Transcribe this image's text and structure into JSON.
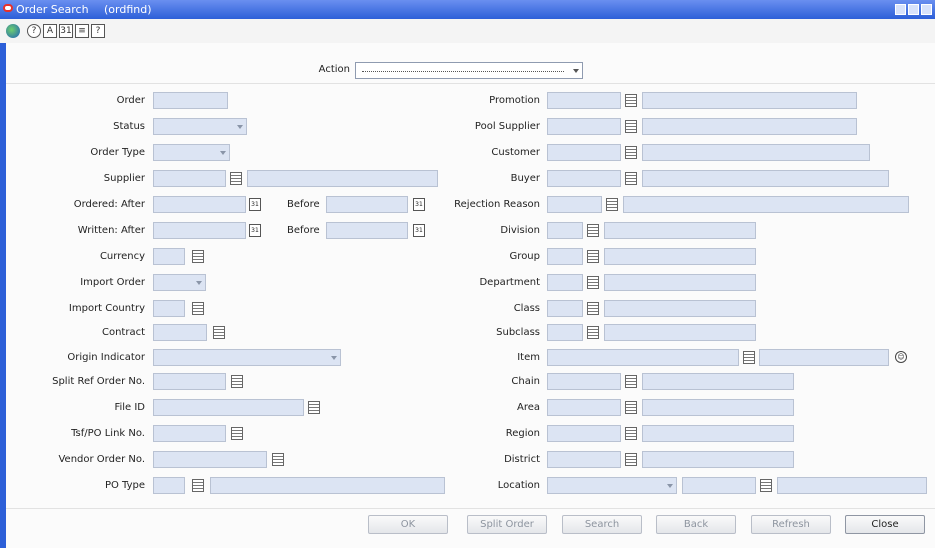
{
  "window": {
    "title": "Order Search",
    "form_name": "(ordfind)"
  },
  "toolbar": {
    "icons": [
      "globe-icon",
      "help-icon",
      "text-icon",
      "calendar-icon",
      "notes-icon",
      "question-icon"
    ]
  },
  "action": {
    "label": "Action",
    "value": ""
  },
  "left": {
    "order": "Order",
    "status": "Status",
    "order_type": "Order Type",
    "supplier": "Supplier",
    "ordered_after": "Ordered: After",
    "written_after": "Written: After",
    "before": "Before",
    "currency": "Currency",
    "import_order": "Import Order",
    "import_country": "Import Country",
    "contract": "Contract",
    "origin_indicator": "Origin Indicator",
    "split_ref": "Split Ref Order No.",
    "file_id": "File ID",
    "tsf_po": "Tsf/PO Link No.",
    "vendor_order": "Vendor Order No.",
    "po_type": "PO Type"
  },
  "right": {
    "promotion": "Promotion",
    "pool_supplier": "Pool Supplier",
    "customer": "Customer",
    "buyer": "Buyer",
    "rejection_reason": "Rejection Reason",
    "division": "Division",
    "group": "Group",
    "department": "Department",
    "class": "Class",
    "subclass": "Subclass",
    "item": "Item",
    "chain": "Chain",
    "area": "Area",
    "region": "Region",
    "district": "District",
    "location": "Location"
  },
  "buttons": {
    "ok": "OK",
    "split_order": "Split Order",
    "search": "Search",
    "back": "Back",
    "refresh": "Refresh",
    "close": "Close"
  },
  "colors": {
    "title_bar": "#2c5fd8",
    "field_bg": "#dce4f3"
  }
}
